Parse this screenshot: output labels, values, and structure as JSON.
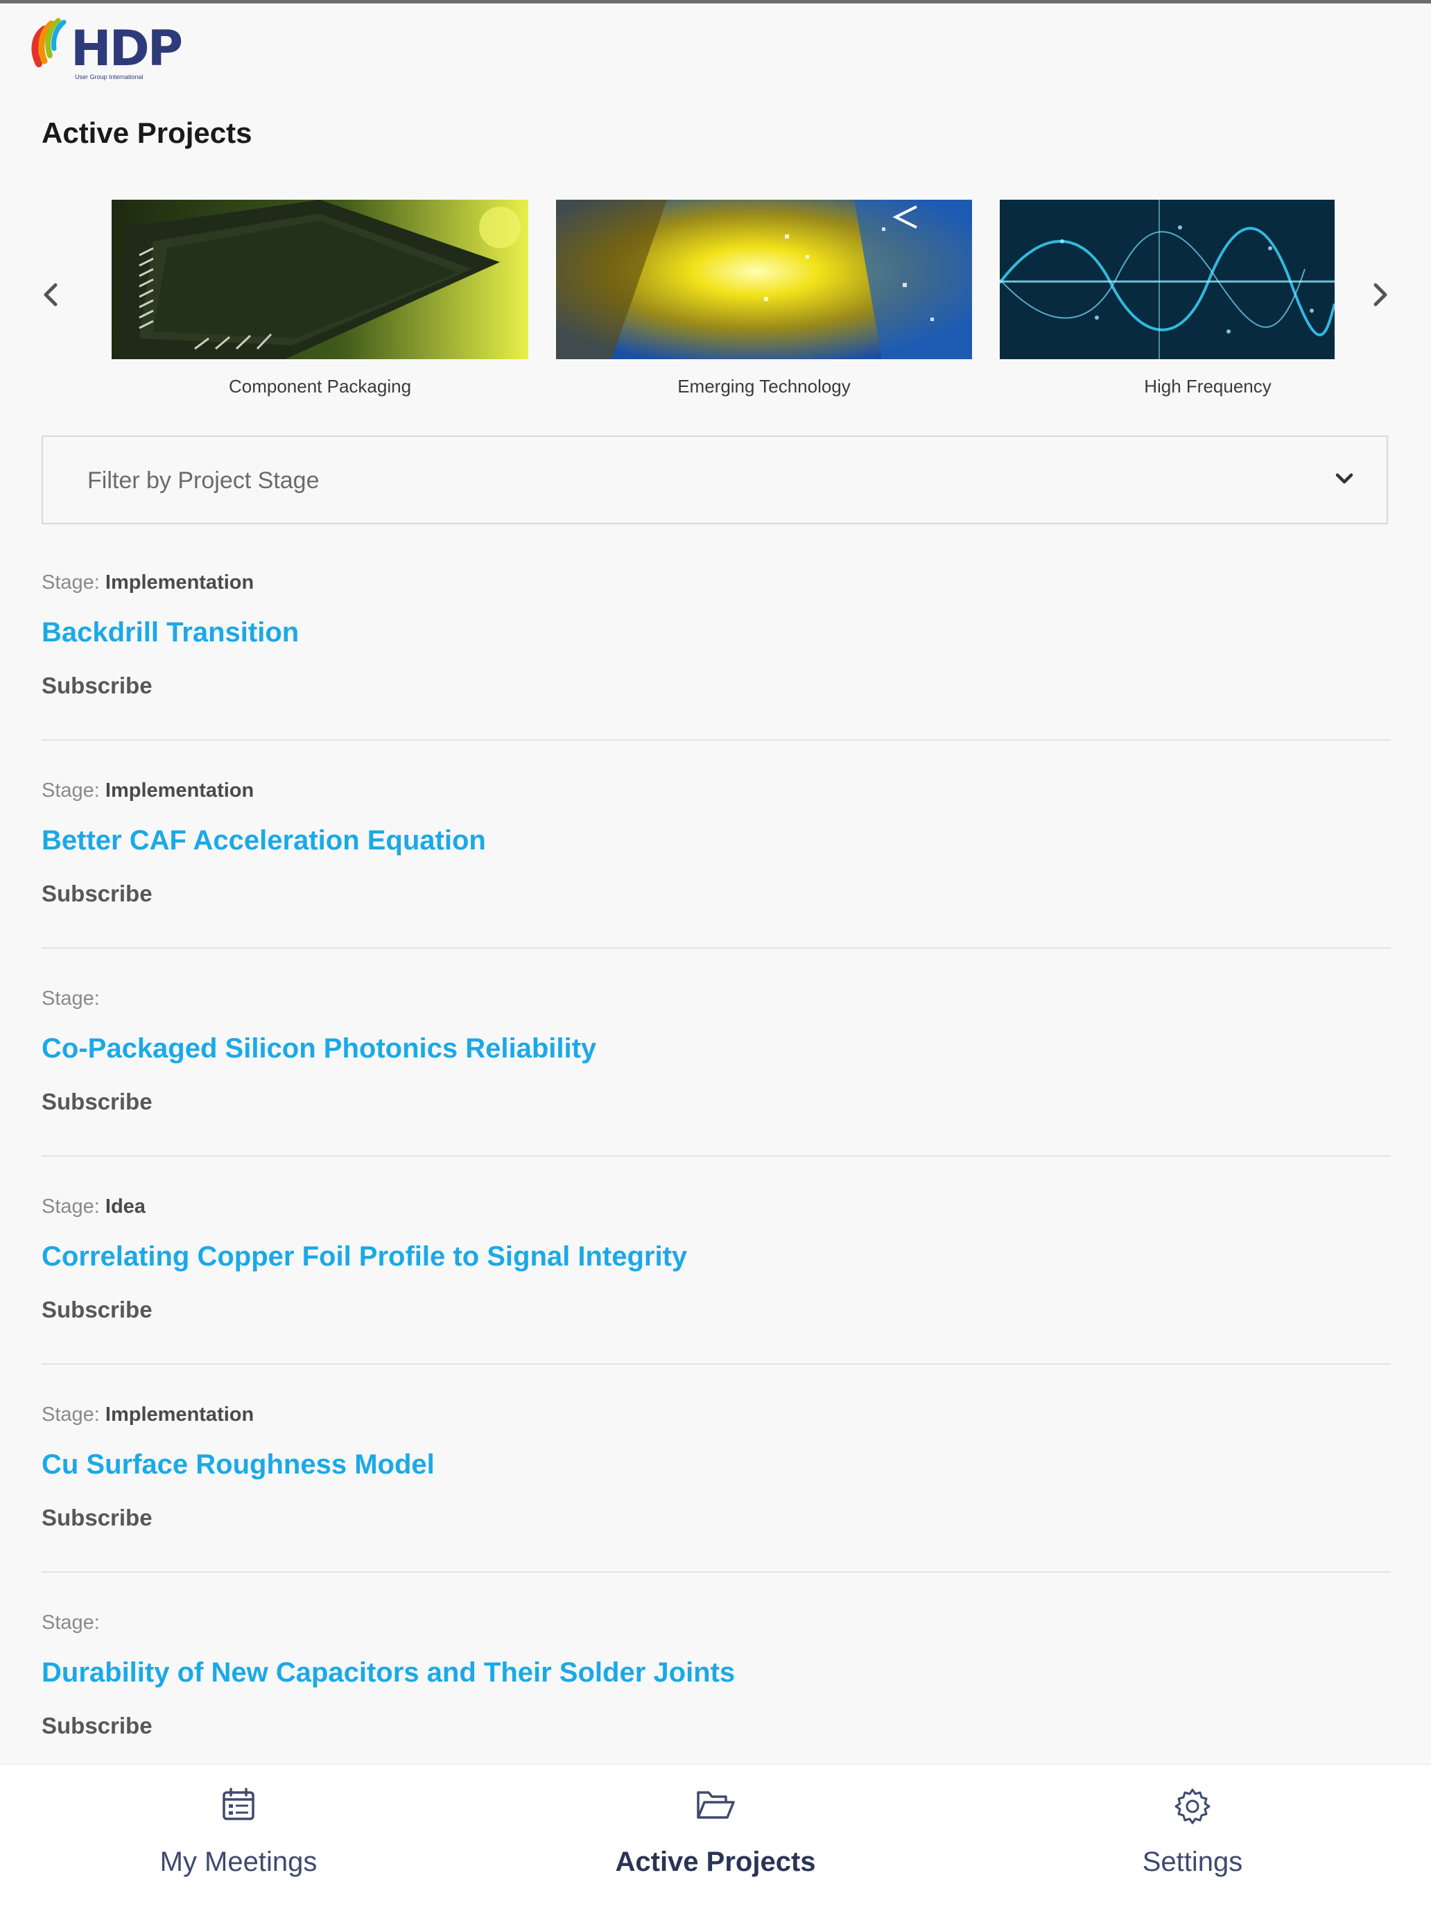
{
  "header": {
    "logo_text": "HDP",
    "logo_subtitle": "User Group International",
    "page_title": "Active Projects"
  },
  "carousel": {
    "prev_icon": "chevron-left-icon",
    "next_icon": "chevron-right-icon",
    "cards": [
      {
        "caption": "Component Packaging"
      },
      {
        "caption": "Emerging Technology"
      },
      {
        "caption": "High Frequency"
      }
    ]
  },
  "filter": {
    "placeholder": "Filter by Project Stage",
    "icon": "chevron-down-icon"
  },
  "projects": [
    {
      "stage_label": "Stage:",
      "stage": "Implementation",
      "title": "Backdrill Transition",
      "action": "Subscribe"
    },
    {
      "stage_label": "Stage:",
      "stage": "Implementation",
      "title": "Better CAF Acceleration Equation",
      "action": "Subscribe"
    },
    {
      "stage_label": "Stage:",
      "stage": "",
      "title": "Co-Packaged Silicon Photonics Reliability",
      "action": "Subscribe"
    },
    {
      "stage_label": "Stage:",
      "stage": "Idea",
      "title": "Correlating Copper Foil Profile to Signal Integrity",
      "action": "Subscribe"
    },
    {
      "stage_label": "Stage:",
      "stage": "Implementation",
      "title": "Cu Surface Roughness Model",
      "action": "Subscribe"
    },
    {
      "stage_label": "Stage:",
      "stage": "",
      "title": "Durability of New Capacitors and Their Solder Joints",
      "action": "Subscribe"
    }
  ],
  "bottom_nav": {
    "items": [
      {
        "label": "My Meetings",
        "icon": "calendar-icon"
      },
      {
        "label": "Active Projects",
        "icon": "folder-open-icon",
        "active": true
      },
      {
        "label": "Settings",
        "icon": "gear-icon"
      }
    ]
  },
  "colors": {
    "link": "#1aa9e8",
    "brand": "#2f3a7a",
    "nav_text": "#3e4a6e"
  }
}
